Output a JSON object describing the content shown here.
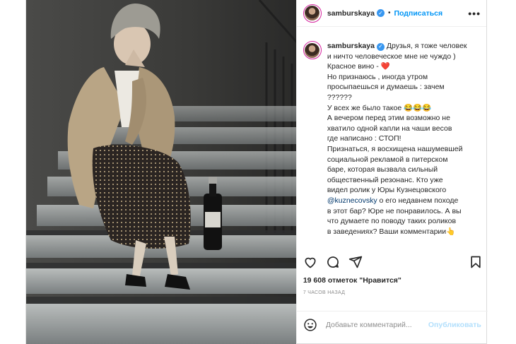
{
  "post": {
    "username": "samburskaya",
    "verified_icon": "verified-badge-icon",
    "follow_label": "Подписаться",
    "more_label": "•••",
    "caption_lines": [
      "Друзья, я тоже человек",
      "и ничто человеческое мне не чуждо )",
      "Красное вино - ❤️",
      "Но признаюсь , иногда утром",
      "просыпаешься и думаешь : зачем",
      "??????",
      "У всех же было такое 😂😂😂",
      "А вечером перед этим возможно не",
      "хватило одной капли на чаши весов",
      "где написано : СТОП!",
      "Признаться, я восхищена нашумевшей",
      "социальной рекламой в питерском",
      "баре, которая вызвала сильный",
      "общественный резонанс. Кто уже",
      "видел ролик у Юры Кузнецовского",
      "@kuznecovsky о его недавнем походе",
      "в этот бар? Юре не понравилось. А вы",
      "что думаете по поводу таких роликов",
      "в заведениях? Ваши комментарии👆"
    ],
    "caption_first_line": "Друзья, я тоже человек",
    "caption_rest": "и ничто человеческое мне не чуждо )\nКрасное вино - ❤️\nНо признаюсь , иногда утром\nпросыпаешься и думаешь : зачем\n??????\nУ всех же было такое 😂😂😂\nА вечером перед этим возможно не\nхватило одной капли на чаши весов\nгде написано : СТОП!\nПризнаться, я восхищена нашумевшей\nсоциальной рекламой в питерском\nбаре, которая вызвала сильный\nобщественный резонанс. Кто уже\nвидел ролик у Юры Кузнецовского\n",
    "mention": "@kuznecovsky",
    "caption_after_mention": " о его недавнем походе\nв этот бар? Юре не понравилось. А вы\nчто думаете по поводу таких роликов\nв заведениях? Ваши комментарии👆",
    "likes_text": "19 608 отметок \"Нравится\"",
    "time_text": "7 часов назад",
    "comment_placeholder": "Добавьте комментарий...",
    "publish_label": "Опубликовать"
  },
  "actions": {
    "like_icon": "heart-icon",
    "comment_icon": "comment-icon",
    "share_icon": "share-icon",
    "save_icon": "bookmark-icon",
    "emoji_icon": "emoji-icon"
  },
  "colors": {
    "link_blue": "#0095f6",
    "publish_disabled": "#b2dffc",
    "verified": "#3897f0",
    "heart": "#ed4956"
  }
}
